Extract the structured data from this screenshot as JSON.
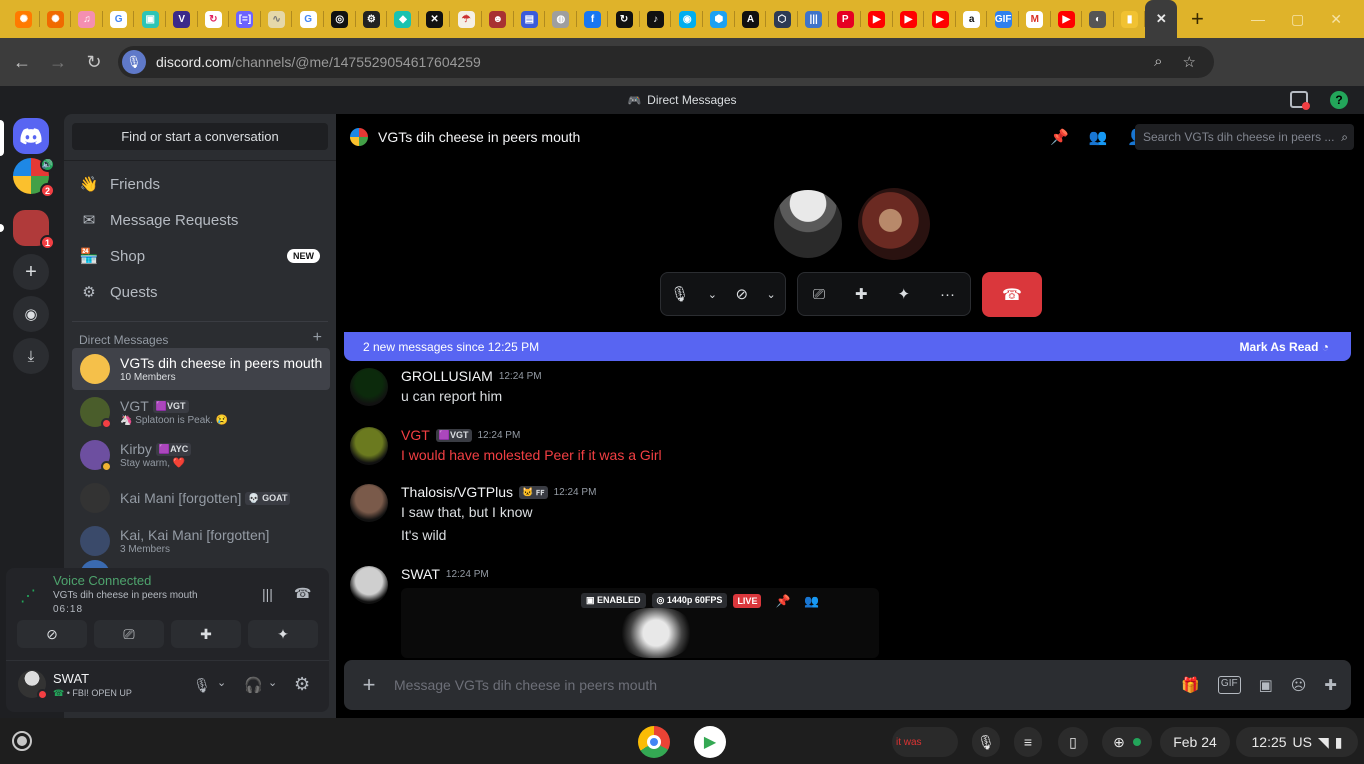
{
  "browser": {
    "tabs": [
      {
        "color": "#ff7a00",
        "glyph": "✺"
      },
      {
        "color": "#f06a00",
        "glyph": "✺"
      },
      {
        "color": "#f48fb1",
        "glyph": "♫"
      },
      {
        "color": "#ffffff",
        "glyph": "G",
        "fg": "#4285f4"
      },
      {
        "color": "#2ec4b6",
        "glyph": "▣"
      },
      {
        "color": "#3b2a8a",
        "glyph": "V"
      },
      {
        "color": "#ffffff",
        "glyph": "↻",
        "fg": "#e0245e"
      },
      {
        "color": "#6c63ff",
        "glyph": "[=]"
      },
      {
        "color": "#e5d8a9",
        "glyph": "∿",
        "fg": "#777"
      },
      {
        "color": "#ffffff",
        "glyph": "G",
        "fg": "#4285f4"
      },
      {
        "color": "#111111",
        "glyph": "◎"
      },
      {
        "color": "#222222",
        "glyph": "⚙"
      },
      {
        "color": "#19c2b0",
        "glyph": "◆"
      },
      {
        "color": "#111111",
        "glyph": "✕"
      },
      {
        "color": "#f5f0e6",
        "glyph": "☂",
        "fg": "#c33"
      },
      {
        "color": "#a83232",
        "glyph": "☻"
      },
      {
        "color": "#3b5bdb",
        "glyph": "▤"
      },
      {
        "color": "#9e9e9e",
        "glyph": "◍"
      },
      {
        "color": "#1877f2",
        "glyph": "f"
      },
      {
        "color": "#111111",
        "glyph": "↻"
      },
      {
        "color": "#111111",
        "glyph": "♪"
      },
      {
        "color": "#00aef0",
        "glyph": "◉"
      },
      {
        "color": "#1da1f2",
        "glyph": "⬢"
      },
      {
        "color": "#111111",
        "glyph": "A"
      },
      {
        "color": "#2e3b55",
        "glyph": "⬡"
      },
      {
        "color": "#3f74c9",
        "glyph": "|||"
      },
      {
        "color": "#e60023",
        "glyph": "P"
      },
      {
        "color": "#ff0000",
        "glyph": "▶"
      },
      {
        "color": "#ff0000",
        "glyph": "▶"
      },
      {
        "color": "#ff0000",
        "glyph": "▶"
      },
      {
        "color": "#ffffff",
        "glyph": "a",
        "fg": "#111"
      },
      {
        "color": "#2f80ed",
        "glyph": "GIF"
      },
      {
        "color": "#ffffff",
        "glyph": "M",
        "fg": "#d93025"
      },
      {
        "color": "#ff0000",
        "glyph": "▶"
      },
      {
        "color": "#555555",
        "glyph": "◐"
      },
      {
        "color": "#f1c232",
        "glyph": "▮"
      },
      {
        "color": "#5865f2",
        "glyph": "✕",
        "active": true
      }
    ],
    "new_tab": "+",
    "url_domain": "discord.com",
    "url_path": "/channels/@me/1475529054617604259"
  },
  "titlebar": {
    "label": "Direct Messages"
  },
  "sidebar": {
    "search_placeholder": "Find or start a conversation",
    "nav": [
      {
        "label": "Friends",
        "icon": "person-wave-icon"
      },
      {
        "label": "Message Requests",
        "icon": "envelope-icon"
      },
      {
        "label": "Shop",
        "icon": "shop-icon",
        "badge": "NEW"
      },
      {
        "label": "Quests",
        "icon": "quests-icon"
      }
    ],
    "dm_header": "Direct Messages",
    "dm_add": "+",
    "dms": [
      {
        "name": "VGTs dih cheese in peers mouth",
        "sub": "10 Members",
        "selected": true,
        "color": "#f5c04a"
      },
      {
        "name": "VGT",
        "tag": "🟪VGT",
        "sub": "🦄 Splatoon is Peak. 😢",
        "color": "#4a5d2b",
        "status": "#f23f43"
      },
      {
        "name": "Kirby",
        "tag": "🟪AYC",
        "sub": "Stay warm, ❤️",
        "color": "#6d4fa0",
        "status": "#f0b232"
      },
      {
        "name": "Kai Mani [forgotten]",
        "tag": "💀 GOAT",
        "sub": "",
        "color": "#333333"
      },
      {
        "name": "Kai, Kai Mani [forgotten]",
        "sub": "3 Members",
        "color": "#3a4a6a"
      }
    ]
  },
  "voice": {
    "title": "Voice Connected",
    "channel": "VGTs dih cheese in peers mouth",
    "timer": "06:18"
  },
  "user": {
    "name": "SWAT",
    "status": "• FBI! OPEN UP"
  },
  "channel": {
    "title": "VGTs dih cheese in peers mouth",
    "search_placeholder": "Search VGTs dih cheese in peers ..."
  },
  "new_messages": {
    "text": "2 new messages since 12:25 PM",
    "action": "Mark As Read"
  },
  "messages": [
    {
      "user": "GROLLUSIAM",
      "time": "12:24 PM",
      "lines": [
        "u can report him"
      ],
      "name_color": "#f2f3f5",
      "text_color": "#dbdee1",
      "avatar": "#0c2a0c"
    },
    {
      "user": "VGT",
      "tag": "🟪VGT",
      "time": "12:24 PM",
      "lines": [
        "I would have molested Peer if it was a Girl"
      ],
      "name_color": "#f23f43",
      "text_color": "#f23f43",
      "avatar": "#6b7a1f"
    },
    {
      "user": "Thalosis/VGTPlus",
      "tag": "🐱 ꜰꜰ",
      "time": "12:24 PM",
      "lines": [
        "I saw that, but I know",
        "It's wild"
      ],
      "name_color": "#f2f3f5",
      "text_color": "#dbdee1",
      "avatar": "#7a5a4a"
    },
    {
      "user": "SWAT",
      "time": "12:24 PM",
      "lines": [],
      "name_color": "#f2f3f5",
      "text_color": "#dbdee1",
      "avatar": "#cfcfcf"
    }
  ],
  "stream": {
    "enabled": "ENABLED",
    "quality": "1440p 60FPS",
    "live": "LIVE"
  },
  "composer": {
    "placeholder": "Message VGTs dih cheese in peers mouth"
  },
  "shelf": {
    "date": "Feb 24",
    "time": "12:25",
    "locale": "US",
    "thumb_text": "it was"
  }
}
